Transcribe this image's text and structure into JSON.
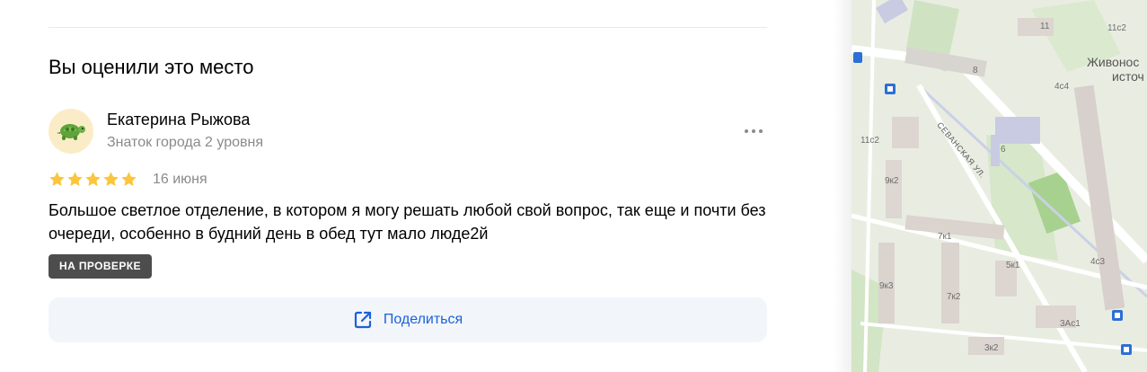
{
  "section": {
    "title": "Вы оценили это место"
  },
  "review": {
    "author_name": "Екатерина Рыжова",
    "author_level": "Знаток города 2 уровня",
    "rating": 5,
    "rating_max": 5,
    "date": "16 июня",
    "text": "Большое светлое отделение, в котором я могу решать любой свой вопрос, так еще и почти без очереди, особенно в будний день в обед тут мало люде2й",
    "status_badge": "НА ПРОВЕРКЕ",
    "share_label": "Поделиться"
  },
  "colors": {
    "star": "#fcc53a",
    "accent": "#1b61d9",
    "badge_bg": "#4d4d4d"
  },
  "icons": [
    "turtle-avatar-icon",
    "more-dots-icon",
    "star-icon",
    "share-icon",
    "bus-stop-icon"
  ],
  "map": {
    "labels": [
      "11",
      "11с2",
      "8",
      "Живонос",
      "источ",
      "4с4",
      "11с2",
      "6",
      "9к2",
      "7к1",
      "5к1",
      "4с3",
      "9к3",
      "7к2",
      "3Ас1",
      "3к2"
    ],
    "street": "СЕВАНСКАЯ УЛ."
  }
}
